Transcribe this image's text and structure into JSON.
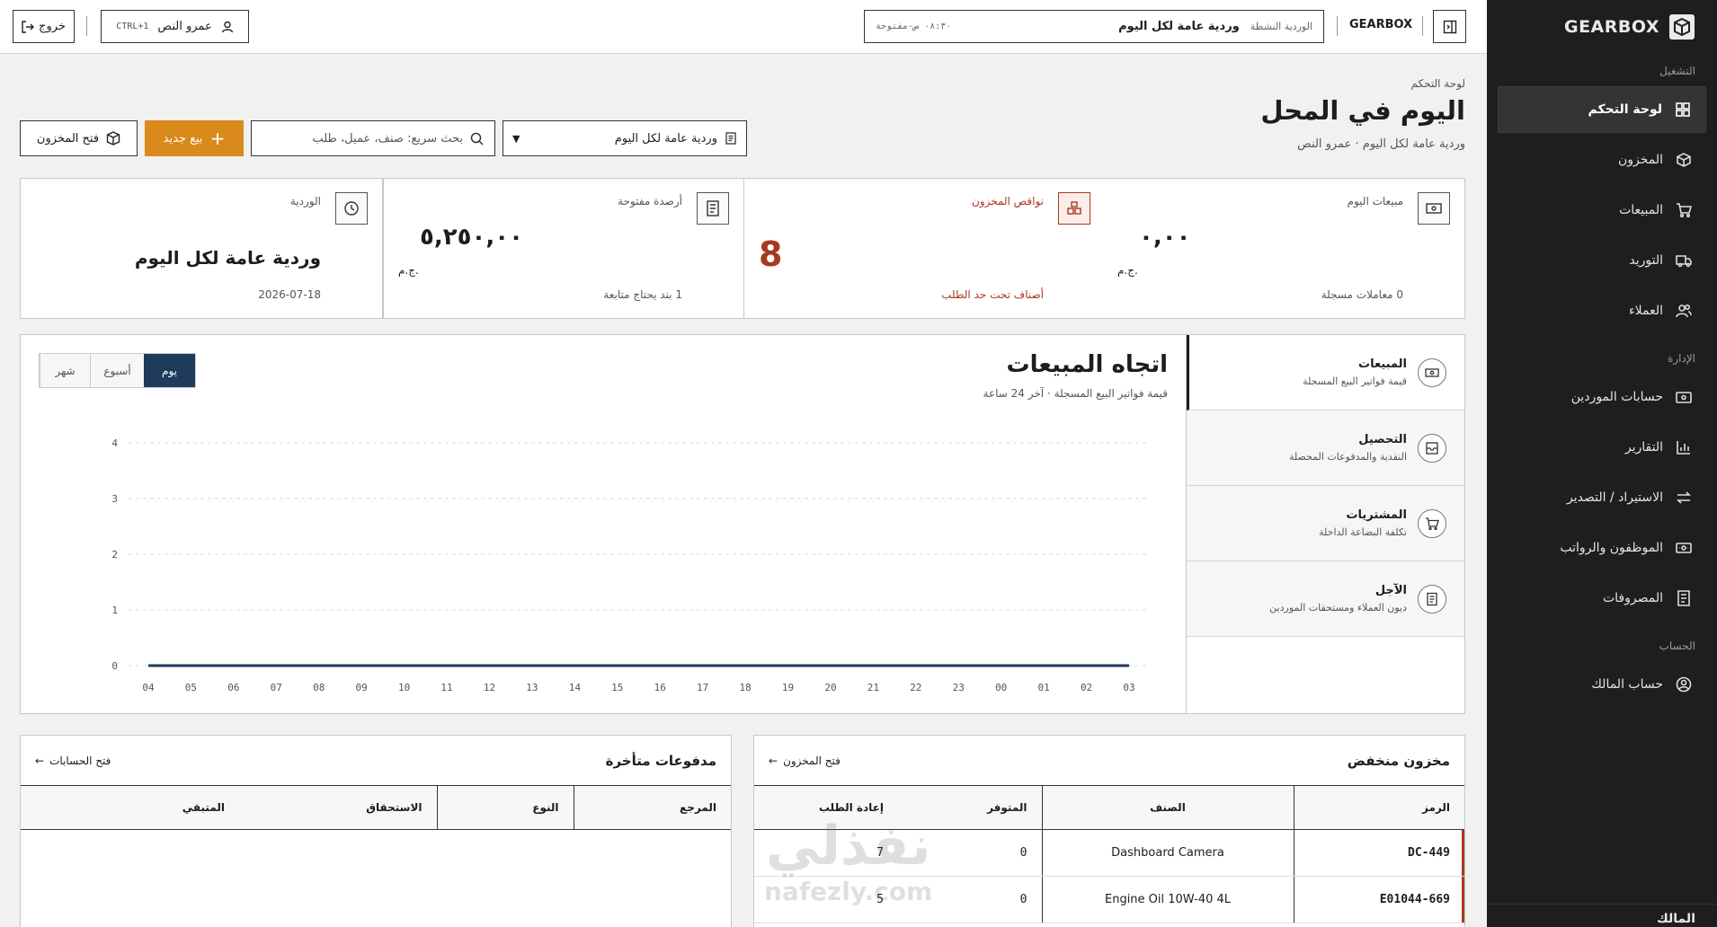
{
  "brand": {
    "name": "GEARBOX"
  },
  "sidebar": {
    "sections": {
      "operate": "التشغيل",
      "admin": "الإدارة",
      "account": "الحساب"
    },
    "items": [
      {
        "label": "لوحة التحكم",
        "icon": "dashboard-icon"
      },
      {
        "label": "المخزون",
        "icon": "box-icon"
      },
      {
        "label": "المبيعات",
        "icon": "cart-icon"
      },
      {
        "label": "التوريد",
        "icon": "truck-icon"
      },
      {
        "label": "العملاء",
        "icon": "users-icon"
      },
      {
        "label": "حسابات الموردين",
        "icon": "wallet-icon"
      },
      {
        "label": "التقارير",
        "icon": "bar-chart-icon"
      },
      {
        "label": "الاستيراد / التصدير",
        "icon": "swap-icon"
      },
      {
        "label": "الموظفون والرواتب",
        "icon": "payroll-icon"
      },
      {
        "label": "المصروفات",
        "icon": "receipt-icon"
      },
      {
        "label": "حساب المالك",
        "icon": "account-icon"
      }
    ],
    "footer": "المالك"
  },
  "topbar": {
    "brand": "GEARBOX",
    "shift_label": "الوردية النشطة",
    "shift_name": "وردية عامة لكل اليوم",
    "shift_status": "٠٨:٣٠ ص-مفتوحة",
    "user_name": "عمرو النص",
    "user_shortcut": "CTRL+1",
    "logout_label": "خروج"
  },
  "page": {
    "breadcrumb": "لوحة التحكم",
    "title": "اليوم في المحل",
    "subtitle": "وردية عامة لكل اليوم · عمرو النص",
    "shift_select": "وردية عامة لكل اليوم",
    "search_placeholder": "بحث سريع: صنف، عميل، طلب",
    "new_sale": "بيع جديد",
    "open_inventory": "فتح المخزون"
  },
  "kpis": {
    "sales": {
      "label": "مبيعات اليوم",
      "value": "٠,٠٠",
      "currency": "ج.م.",
      "note": "0 معاملات مسجلة"
    },
    "shortages": {
      "label": "نواقص المخزون",
      "value": "8",
      "note": "أصناف تحت حد الطلب"
    },
    "balances": {
      "label": "أرصدة مفتوحة",
      "value": "٥,٢٥٠,٠٠",
      "currency": "ج.م.",
      "note": "1 بند يحتاج متابعة"
    },
    "shift": {
      "label": "الوردية",
      "value": "وردية عامة لكل اليوم",
      "note": "2026-07-18"
    }
  },
  "trend": {
    "title": "اتجاه المبيعات",
    "subtitle": "قيمة فواتير البيع المسجلة · آخر 24 ساعة",
    "tabs": [
      "يوم",
      "أسبوع",
      "شهر"
    ],
    "active_tab": "يوم",
    "side": [
      {
        "title": "المبيعات",
        "sub": "قيمة فواتير البيع المسجلة",
        "icon": "money-icon"
      },
      {
        "title": "التحصيل",
        "sub": "النقدية والمدفوعات المحصلة",
        "icon": "inbox-icon"
      },
      {
        "title": "المشتريات",
        "sub": "تكلفة البضاعة الداخلة",
        "icon": "cart-icon"
      },
      {
        "title": "الآجل",
        "sub": "ديون العملاء ومستحقات الموردين",
        "icon": "document-icon"
      }
    ]
  },
  "chart_data": {
    "type": "line",
    "title": "اتجاه المبيعات",
    "categories": [
      "04",
      "05",
      "06",
      "07",
      "08",
      "09",
      "10",
      "11",
      "12",
      "13",
      "14",
      "15",
      "16",
      "17",
      "18",
      "19",
      "20",
      "21",
      "22",
      "23",
      "00",
      "01",
      "02",
      "03"
    ],
    "series": [
      {
        "values": [
          0,
          0,
          0,
          0,
          0,
          0,
          0,
          0,
          0,
          0,
          0,
          0,
          0,
          0,
          0,
          0,
          0,
          0,
          0,
          0,
          0,
          0,
          0,
          0
        ]
      }
    ],
    "yticks": [
      "0",
      "1",
      "2",
      "3",
      "4"
    ],
    "ylim": [
      0,
      4
    ],
    "grid": true,
    "color": "#1f3b5c"
  },
  "low_stock": {
    "title": "مخزون منخفض",
    "link": "فتح المخزون",
    "headers": {
      "code": "الرمز",
      "item": "الصنف",
      "available": "المتوفر",
      "reorder": "إعادة الطلب"
    },
    "rows": [
      {
        "code": "DC-449",
        "item": "Dashboard Camera",
        "available": "0",
        "reorder": "7"
      },
      {
        "code": "E01044-669",
        "item": "Engine Oil 10W-40 4L",
        "available": "0",
        "reorder": "5"
      }
    ]
  },
  "overdue": {
    "title": "مدفوعات متأخرة",
    "link": "فتح الحسابات",
    "headers": {
      "ref": "المرجع",
      "type": "النوع",
      "due": "الاستحقاق",
      "remaining": "المتبقي"
    }
  },
  "watermark": {
    "text": "نفذلي",
    "url": "nafezly.com"
  },
  "colors": {
    "accent": "#d98a1a",
    "navy": "#1f3b5c",
    "danger": "#a63a20",
    "sidebar": "#1e1e1e"
  }
}
